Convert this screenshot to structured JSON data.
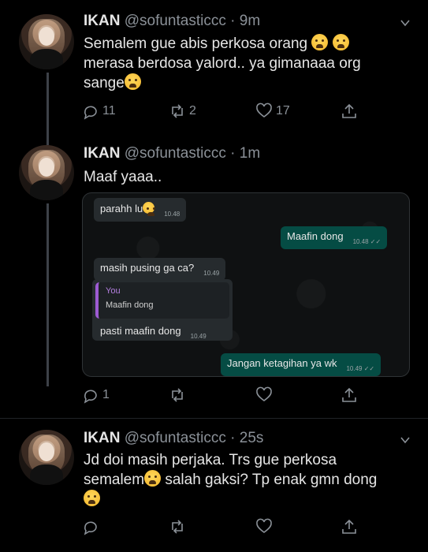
{
  "tweets": [
    {
      "name": "IKAN",
      "handle": "@sofuntasticcc",
      "time": "· 9m",
      "line1": "Semalem gue abis perkosa orang",
      "line2": "merasa berdosa yalord.. ya gimanaaa org",
      "line3": "sange",
      "replies": "11",
      "retweets": "2",
      "likes": "17"
    },
    {
      "name": "IKAN",
      "handle": "@sofuntasticcc",
      "time": "· 1m",
      "line1": "Maaf yaaa..",
      "replies": "1",
      "retweets": "",
      "likes": ""
    },
    {
      "name": "IKAN",
      "handle": "@sofuntasticcc",
      "time": "· 25s",
      "line1": "Jd doi masih perjaka. Trs gue perkosa",
      "line2a": "semalem",
      "line2b": "salah gaksi? Tp enak gmn dong",
      "replies": "",
      "retweets": "",
      "likes": ""
    }
  ],
  "chat": {
    "m1": {
      "text": "parahh lu",
      "time": "10.48"
    },
    "m2": {
      "text": "Maafin dong",
      "time": "10.48 ✓✓"
    },
    "m3": {
      "text": "masih pusing ga ca?",
      "time": "10.49"
    },
    "quote_author": "You",
    "quote_text": "Maafin dong",
    "m4": {
      "text": "pasti maafin dong",
      "time": "10.49"
    },
    "m5": {
      "text": "Jangan ketagihan ya wk",
      "time": "10.49 ✓✓"
    }
  },
  "icons": [
    "reply-icon",
    "retweet-icon",
    "like-icon",
    "share-icon",
    "chevron-down-icon",
    "emoji-weary",
    "emoji-sob",
    "emoji-grin-tongue"
  ]
}
